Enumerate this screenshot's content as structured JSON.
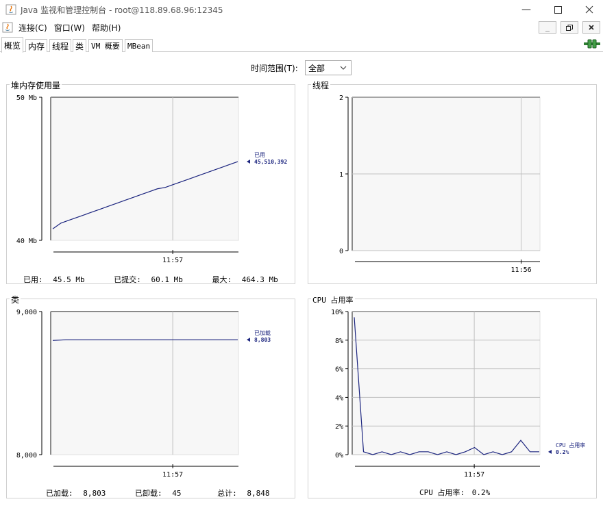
{
  "window": {
    "title": "Java 监视和管理控制台 - root@118.89.68.96:12345"
  },
  "menu": {
    "connect": "连接(C)",
    "window": "窗口(W)",
    "help": "帮助(H)"
  },
  "tabs": [
    {
      "label": "概览"
    },
    {
      "label": "内存"
    },
    {
      "label": "线程"
    },
    {
      "label": "类"
    },
    {
      "label": "VM 概要"
    },
    {
      "label": "MBean"
    }
  ],
  "time_range": {
    "label": "时间范围(T):",
    "selected": "全部"
  },
  "panels": {
    "heap": {
      "title": "堆内存使用量",
      "footer": {
        "used_label": "已用:",
        "used_value": "45.5  Mb",
        "committed_label": "已提交:",
        "committed_value": "60.1  Mb",
        "max_label": "最大:",
        "max_value": "464.3  Mb"
      }
    },
    "threads": {
      "title": "线程"
    },
    "classes": {
      "title": "类",
      "footer": {
        "loaded_label": "已加载:",
        "loaded_value": "8,803",
        "unloaded_label": "已卸载:",
        "unloaded_value": "45",
        "total_label": "总计:",
        "total_value": "8,848"
      }
    },
    "cpu": {
      "title": "CPU 占用率",
      "footer": {
        "label": "CPU 占用率:",
        "value": "0.2%"
      }
    }
  },
  "colors": {
    "series": "#1a237e",
    "plot_bg": "#f7f7f7",
    "grid": "#c0c0c0"
  },
  "chart_data": [
    {
      "id": "heap",
      "type": "line",
      "ylim": [
        40,
        50
      ],
      "ytick_labels": [
        "50 Mb",
        "40 Mb"
      ],
      "xtick_labels": [
        "11:57"
      ],
      "series": [
        {
          "name": "已用",
          "values": [
            40.8,
            41.2,
            41.4,
            41.6,
            41.8,
            42.0,
            42.2,
            42.4,
            42.6,
            42.8,
            43.0,
            43.2,
            43.4,
            43.6,
            43.7,
            43.9,
            44.1,
            44.3,
            44.5,
            44.7,
            44.9,
            45.1,
            45.3,
            45.5
          ]
        }
      ],
      "last_label": "已用",
      "last_value": "45,510,392"
    },
    {
      "id": "threads",
      "type": "line",
      "ylim": [
        0,
        2
      ],
      "ytick_labels": [
        "2",
        "1",
        "0"
      ],
      "xtick_labels": [
        "11:56"
      ],
      "series": []
    },
    {
      "id": "classes",
      "type": "line",
      "ylim": [
        8000,
        9000
      ],
      "ytick_labels": [
        "9,000",
        "8,000"
      ],
      "xtick_labels": [
        "11:57"
      ],
      "series": [
        {
          "name": "已加载",
          "values": [
            8798,
            8803,
            8803,
            8803,
            8803,
            8803,
            8803,
            8803,
            8803,
            8803,
            8803,
            8803,
            8803,
            8803,
            8803
          ]
        }
      ],
      "last_label": "已加载",
      "last_value": "8,803"
    },
    {
      "id": "cpu",
      "type": "line",
      "ylim": [
        0,
        10
      ],
      "ytick_labels": [
        "10%",
        "8%",
        "6%",
        "4%",
        "2%",
        "0%"
      ],
      "xtick_labels": [
        "11:57"
      ],
      "series": [
        {
          "name": "CPU 占用率",
          "values": [
            9.6,
            0.2,
            0.0,
            0.2,
            0.0,
            0.2,
            0.0,
            0.2,
            0.2,
            0.0,
            0.2,
            0.0,
            0.2,
            0.5,
            0.0,
            0.2,
            0.0,
            0.2,
            1.0,
            0.2,
            0.2
          ]
        }
      ],
      "last_label": "CPU 占用率",
      "last_value": "0.2%"
    }
  ]
}
